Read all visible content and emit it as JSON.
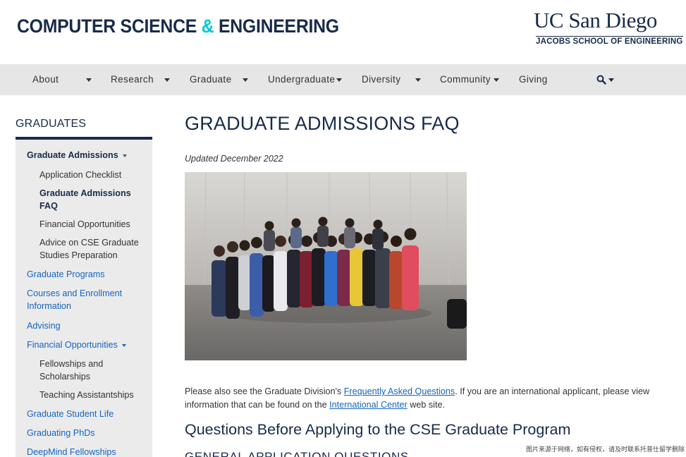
{
  "header": {
    "site_title_part1": "COMPUTER SCIENCE ",
    "site_title_amp": "&",
    "site_title_part2": " ENGINEERING",
    "logo_main": "UC San Diego",
    "logo_sub": "JACOBS SCHOOL OF ENGINEERING"
  },
  "nav": {
    "items": [
      {
        "label": "About",
        "has_dropdown": true
      },
      {
        "label": "Research",
        "has_dropdown": true
      },
      {
        "label": "Graduate",
        "has_dropdown": true
      },
      {
        "label": "Undergraduate",
        "has_dropdown": true
      },
      {
        "label": "Diversity",
        "has_dropdown": true
      },
      {
        "label": "Community",
        "has_dropdown": true
      },
      {
        "label": "Giving",
        "has_dropdown": false
      }
    ],
    "search_icon": "search-icon"
  },
  "sidebar": {
    "heading": "GRADUATES",
    "items": [
      {
        "label": "Graduate Admissions",
        "type": "active-parent"
      },
      {
        "label": "Application Checklist",
        "type": "sub"
      },
      {
        "label": "Graduate Admissions",
        "label2": "FAQ",
        "type": "current"
      },
      {
        "label": "Financial Opportunities",
        "type": "sub"
      },
      {
        "label": "Advice on CSE Graduate",
        "label2": "Studies Preparation",
        "type": "sub"
      },
      {
        "label": "Graduate Programs",
        "type": "link"
      },
      {
        "label": "Courses and Enrollment",
        "label2": "Information",
        "type": "link"
      },
      {
        "label": "Advising",
        "type": "link"
      },
      {
        "label": "Financial Opportunities",
        "type": "link-dropdown"
      },
      {
        "label": "Fellowships and",
        "label2": "Scholarships",
        "type": "sub"
      },
      {
        "label": "Teaching Assistantships",
        "type": "sub"
      },
      {
        "label": "Graduate Student Life",
        "type": "link"
      },
      {
        "label": "Graduating PhDs",
        "type": "link"
      },
      {
        "label": "DeepMind Fellowships",
        "type": "link"
      }
    ]
  },
  "main": {
    "title": "GRADUATE ADMISSIONS FAQ",
    "updated": "Updated December 2022",
    "intro_1": "Please also see the Graduate Division's ",
    "intro_link_1": "Frequently Asked Questions",
    "intro_2": ". If you are an international applicant, please view information that can be found on the ",
    "intro_link_2": "International Center",
    "intro_3": " web site.",
    "section_heading": "Questions Before Applying to the CSE Graduate Program",
    "subsection_heading": "GENERAL APPLICATION QUESTIONS"
  },
  "watermark": "图片来源于网络，如有侵权，请及时联系托普仕留学删除",
  "colors": {
    "navy": "#182b49",
    "accent": "#00c6d7",
    "link": "#1565c0",
    "nav_bg": "#e6e6e6",
    "sidebar_bg": "#ebebeb"
  }
}
